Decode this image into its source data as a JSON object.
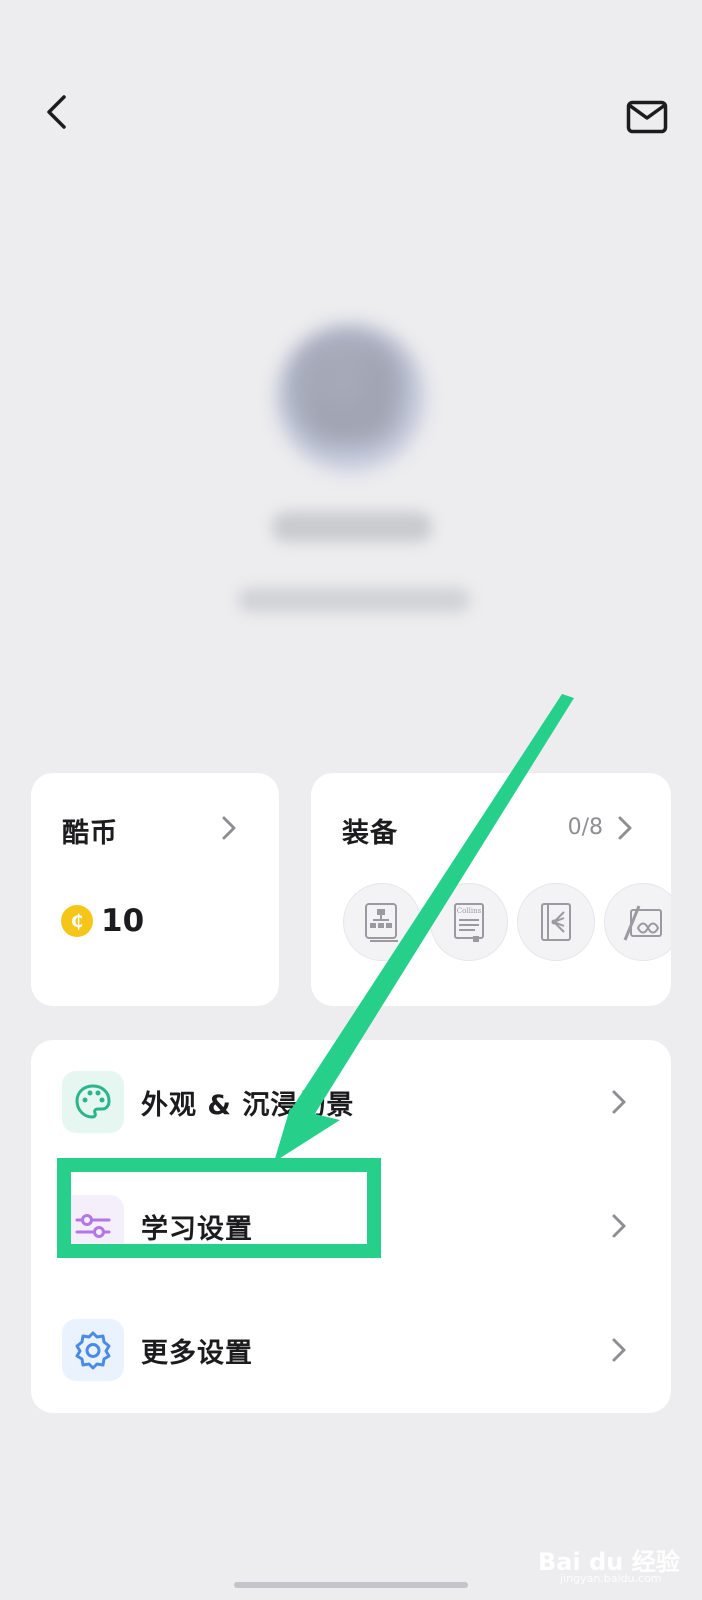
{
  "cards": {
    "coins": {
      "title": "酷币",
      "value": "10"
    },
    "equipment": {
      "title": "装备",
      "count": "0/8",
      "items": [
        {
          "icon": "mindmap-book-icon"
        },
        {
          "icon": "collins-dictionary-icon",
          "label": "Collins"
        },
        {
          "icon": "tree-book-icon"
        },
        {
          "icon": "pencil-infinity-icon"
        }
      ]
    }
  },
  "settings": {
    "items": [
      {
        "label": "外观 & 沉浸场景",
        "icon": "palette-icon",
        "icon_bg": "#e6f6f0",
        "icon_color": "#2bb58d"
      },
      {
        "label": "学习设置",
        "icon": "sliders-icon",
        "icon_bg": "#f4effb",
        "icon_color": "#b376e6"
      },
      {
        "label": "更多设置",
        "icon": "gear-icon",
        "icon_bg": "#eaf2fd",
        "icon_color": "#4a8be8"
      }
    ]
  },
  "annotation": {
    "color": "#27d08a"
  },
  "watermark": {
    "text": "Bai du 经验",
    "subtext": "jingyan.baidu.com"
  }
}
